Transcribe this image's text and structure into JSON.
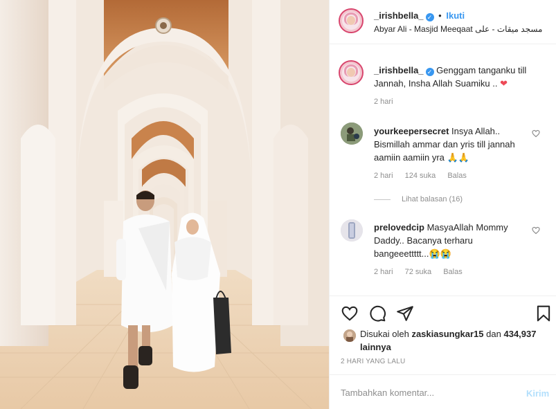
{
  "post": {
    "username": "_irishbella_",
    "verified_symbol": "✓",
    "separator": "•",
    "follow_label": "Ikuti",
    "location": "Abyar Ali - Masjid Meeqaat مسجد ميقات - على"
  },
  "caption": {
    "username": "_irishbella_",
    "text": "Genggam tanganku till Jannah, Insha Allah Suamiku ..",
    "emoji": "❤",
    "time": "2 hari"
  },
  "comments": [
    {
      "username": "yourkeepersecret",
      "text": "Insya Allah.. Bismillah ammar dan yris till jannah aamiin aamiin yra 🙏🙏",
      "time": "2 hari",
      "likes": "124 suka",
      "reply_label": "Balas",
      "view_replies": "Lihat balasan (16)"
    },
    {
      "username": "prelovedcip",
      "text": "MasyaAllah Mommy Daddy.. Bacanya terharu bangeeettttt...😭😭",
      "time": "2 hari",
      "likes": "72 suka",
      "reply_label": "Balas"
    }
  ],
  "likes": {
    "prefix": "Disukai oleh",
    "liker": "zaskiasungkar15",
    "connector": "dan",
    "count": "434,937 lainnya"
  },
  "post_time": "2 HARI YANG LALU",
  "add_comment": {
    "placeholder": "Tambahkan komentar...",
    "post_label": "Kirim"
  },
  "icons": {
    "like": "heart-outline-icon",
    "comment": "comment-bubble-icon",
    "share": "paper-plane-icon",
    "save": "bookmark-icon",
    "comment_like": "small-heart-icon"
  },
  "colors": {
    "link_blue": "#3897f0",
    "muted": "#8e8e8e",
    "post_disabled": "#b2dffc",
    "heart_red": "#ed4956"
  }
}
